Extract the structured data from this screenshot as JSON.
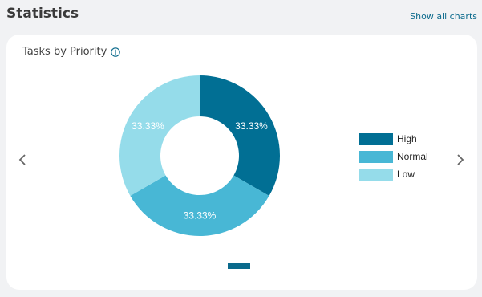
{
  "header": {
    "title": "Statistics",
    "show_all_label": "Show all charts"
  },
  "card": {
    "title": "Tasks by Priority",
    "info_icon": "info-icon",
    "prev_icon": "chevron-left-icon",
    "next_icon": "chevron-right-icon"
  },
  "colors": {
    "high": "#016f94",
    "normal": "#48b7d5",
    "low": "#95dcea",
    "link": "#0b6a8c"
  },
  "chart_data": {
    "type": "pie",
    "donut": true,
    "title": "Tasks by Priority",
    "categories": [
      "High",
      "Normal",
      "Low"
    ],
    "values": [
      33.33,
      33.33,
      33.33
    ],
    "labels": [
      "33.33%",
      "33.33%",
      "33.33%"
    ],
    "colors": [
      "#016f94",
      "#48b7d5",
      "#95dcea"
    ],
    "legend_position": "right"
  },
  "legend": {
    "items": [
      {
        "label": "High",
        "color": "#016f94"
      },
      {
        "label": "Normal",
        "color": "#48b7d5"
      },
      {
        "label": "Low",
        "color": "#95dcea"
      }
    ]
  },
  "pager": {
    "page_count": 1,
    "active_index": 0
  }
}
